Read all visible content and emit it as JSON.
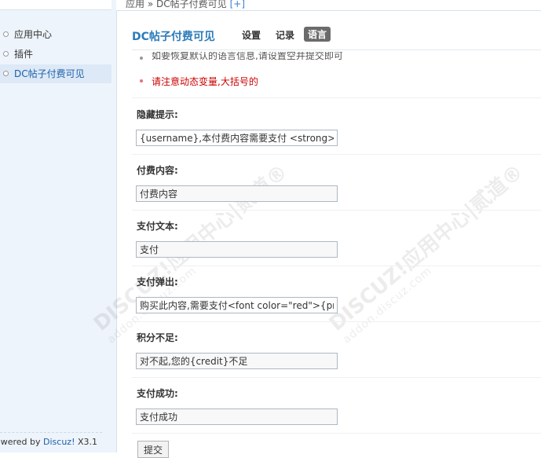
{
  "breadcrumb": {
    "text": "应用 » DC帖子付费可见",
    "plus": "[+]"
  },
  "sidebar": {
    "items": [
      {
        "label": "应用中心"
      },
      {
        "label": "插件"
      },
      {
        "label": "DC帖子付费可见"
      }
    ],
    "footer_prefix": "owered by ",
    "footer_brand": "Discuz!",
    "footer_version": " X3.1"
  },
  "header": {
    "title": "DC帖子付费可见",
    "tabs": [
      {
        "label": "设置"
      },
      {
        "label": "记录"
      },
      {
        "label": "语言"
      }
    ]
  },
  "tips": [
    "如要恢复默认的语言信息,请设置空并提交即可",
    "请注意动态变量,大括号的"
  ],
  "fields": [
    {
      "label": "隐藏提示:",
      "value": "{username},本付费内容需要支付 <strong>"
    },
    {
      "label": "付费内容:",
      "value": "付费内容"
    },
    {
      "label": "支付文本:",
      "value": "支付"
    },
    {
      "label": "支付弹出:",
      "value": "购买此内容,需要支付<font color=\"red\">{pri"
    },
    {
      "label": "积分不足:",
      "value": "对不起,您的{credit}不足"
    },
    {
      "label": "支付成功:",
      "value": "支付成功"
    }
  ],
  "submit_label": "提交",
  "watermark": {
    "main": "DISCUZ!应用中心|贰道®",
    "sub": "addon.discuz.com"
  },
  "colors": {
    "accent": "#2b7bb9",
    "warning": "#cc0000",
    "active_tab": "#6b6b6b"
  }
}
